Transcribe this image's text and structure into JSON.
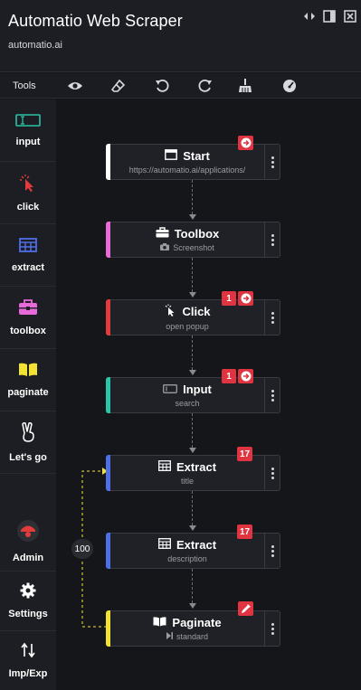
{
  "header": {
    "title": "Automatio Web Scraper",
    "subtitle": "automatio.ai",
    "controls": [
      "resize-icon",
      "dock-icon",
      "close-icon"
    ]
  },
  "toolbar": {
    "label": "Tools",
    "icons": [
      "eye-icon",
      "eraser-icon",
      "undo-icon",
      "redo-icon",
      "broom-icon",
      "speedometer-icon"
    ]
  },
  "sidebar": {
    "items": [
      {
        "label": "input",
        "icon": "text-cursor-icon",
        "color": "#2bc4a8"
      },
      {
        "label": "click",
        "icon": "cursor-click-icon",
        "color": "#e23b3b"
      },
      {
        "label": "extract",
        "icon": "table-icon",
        "color": "#4f6fe8"
      },
      {
        "label": "toolbox",
        "icon": "toolbox-icon",
        "color": "#e86ad9"
      },
      {
        "label": "paginate",
        "icon": "book-icon",
        "color": "#f2e233"
      },
      {
        "label": "Let's go",
        "icon": "victory-hand-icon",
        "color": "#ffffff"
      },
      {
        "label": "Admin",
        "icon": "admin-avatar-icon",
        "color": "#e23b3b"
      },
      {
        "label": "Settings",
        "icon": "gear-icon",
        "color": "#ffffff"
      },
      {
        "label": "Imp/Exp",
        "icon": "import-export-icon",
        "color": "#ffffff"
      }
    ]
  },
  "flow": {
    "loop_count": "100",
    "nodes": [
      {
        "title": "Start",
        "subtitle": "https://automatio.ai/applications/",
        "icon": "browser-window-icon",
        "sub_icon": "",
        "color": "#ffffff",
        "badge_count": "",
        "badge_icon": "arrow-circle-right-icon"
      },
      {
        "title": "Toolbox",
        "subtitle": "Screenshot",
        "icon": "toolbox-icon",
        "sub_icon": "camera-icon",
        "color": "#e86ad9",
        "badge_count": "",
        "badge_icon": ""
      },
      {
        "title": "Click",
        "subtitle": "open popup",
        "icon": "cursor-click-icon",
        "sub_icon": "",
        "color": "#e23b3b",
        "badge_count": "1",
        "badge_icon": "arrow-circle-right-icon"
      },
      {
        "title": "Input",
        "subtitle": "search",
        "icon": "text-input-icon",
        "sub_icon": "",
        "color": "#2bc4a8",
        "badge_count": "1",
        "badge_icon": "arrow-circle-right-icon"
      },
      {
        "title": "Extract",
        "subtitle": "title",
        "icon": "table-icon",
        "sub_icon": "",
        "color": "#4f6fe8",
        "badge_count": "17",
        "badge_icon": ""
      },
      {
        "title": "Extract",
        "subtitle": "description",
        "icon": "table-icon",
        "sub_icon": "",
        "color": "#4f6fe8",
        "badge_count": "17",
        "badge_icon": ""
      },
      {
        "title": "Paginate",
        "subtitle": "standard",
        "icon": "book-icon",
        "sub_icon": "step-forward-icon",
        "color": "#f2e233",
        "badge_count": "",
        "badge_icon": "eyedropper-icon"
      }
    ]
  }
}
